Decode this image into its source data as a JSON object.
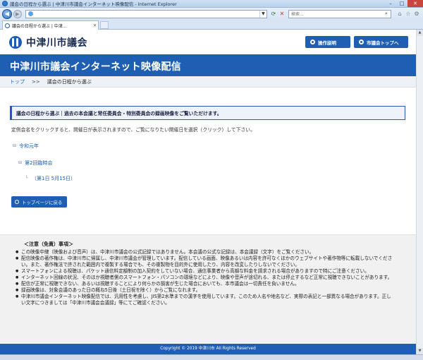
{
  "browser": {
    "window_title": "議会の日程から選ぶ | 中津川市議会インターネット映像配信 - Internet Explorer",
    "search_placeholder": "検索...",
    "tab_label": "議会の日程から選ぶ | 中津...",
    "min_label": "–",
    "max_label": "□",
    "close_label": "✕"
  },
  "site": {
    "logo_text": "中津川市議会",
    "btn_operation": "操作説明",
    "btn_top": "市議会トップへ",
    "banner_title": "中津川市議会インターネット映像配信"
  },
  "breadcrumb": {
    "home": "トップ",
    "sep": ">>",
    "current": "議会の日程から選ぶ"
  },
  "main": {
    "notice": "議会の日程から選ぶ｜過去の本会議と常任委員会・特別委員会の録画映像をご覧いただけます。",
    "instruction": "定例会名をクリックすると、開催日が表示されますので、ご覧になりたい開催日を選択（クリック）して下さい。",
    "tree": {
      "era": "令和元年",
      "session": "第2回臨時会",
      "day": "（第1日 5月15日）"
    },
    "back_button": "トップページに戻る"
  },
  "disclaimer": {
    "title": "＜注意（免責）事項＞",
    "items": [
      "この映像中継（映像および音声）は、中津川市議会の公式記録ではありません。本会議の公式な記録は、本会議録（文字）をご覧ください。",
      "配信映像の著作権は、中津川市に帰属し、中津川市議会が管理しています。配信している画面、映像あるいは内容を許可なくほかのウェブサイトや著作物等に転載しないでください。また、著作権法で許された範囲内で複製する場合でも、その複製物を目的外に使用したり、内容を改変したりしないでください。",
      "スマートフォンによる視聴は、パケット通信料定額制の加入契約をしていない場合、通信事業者から高額な料金を請求される場合がありますので特にご注意ください。",
      "インターネット回線の状況、そのほか視聴者側のスマートフォン・パソコンの環境などにより、映像や音声が途切れる、または停止するなど正常に視聴できないことがあります。",
      "配信が正常に視聴できない、あるいは視聴することにより何らかの損害が生じた場合においても、本市議会は一切責任を負いません。",
      "録画映像は、対象会議のあった日の概ね5日後（土日祝を除く）からご覧になれます。",
      "中津川市議会インターネット映像配信では、汎用性を考慮し、JIS第2水準までの漢字を使用しています。このため人名や地名など、実際の表記と一部異なる場合があります。正しい文字につきましては「中津川市議会会議録」等にてご確認ください。"
    ]
  },
  "footer": {
    "copyright": "Copyright © 2019 中津川市 All Rights Reserved"
  }
}
